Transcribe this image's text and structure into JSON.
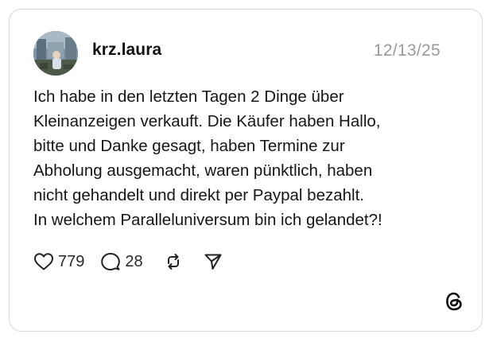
{
  "post": {
    "username": "krz.laura",
    "date": "12/13/25",
    "text_lines": [
      "Ich habe in den letzten Tagen 2 Dinge über",
      "Kleinanzeigen verkauft. Die Käufer haben Hallo,",
      "bitte und Danke gesagt, haben Termine zur",
      "Abholung ausgemacht, waren pünktlich, haben",
      "nicht gehandelt und direkt per Paypal bezahlt.",
      "In welchem Paralleluniversum bin ich gelandet?!"
    ]
  },
  "actions": {
    "likes": "779",
    "replies": "28",
    "like_icon": "heart-icon",
    "reply_icon": "speech-bubble-icon",
    "repost_icon": "repost-arrows-icon",
    "share_icon": "paper-plane-icon"
  },
  "branding": {
    "logo_icon": "threads-logo-icon"
  },
  "colors": {
    "text": "#161616",
    "muted": "#9a9a9a",
    "border": "#d9d9d9"
  }
}
